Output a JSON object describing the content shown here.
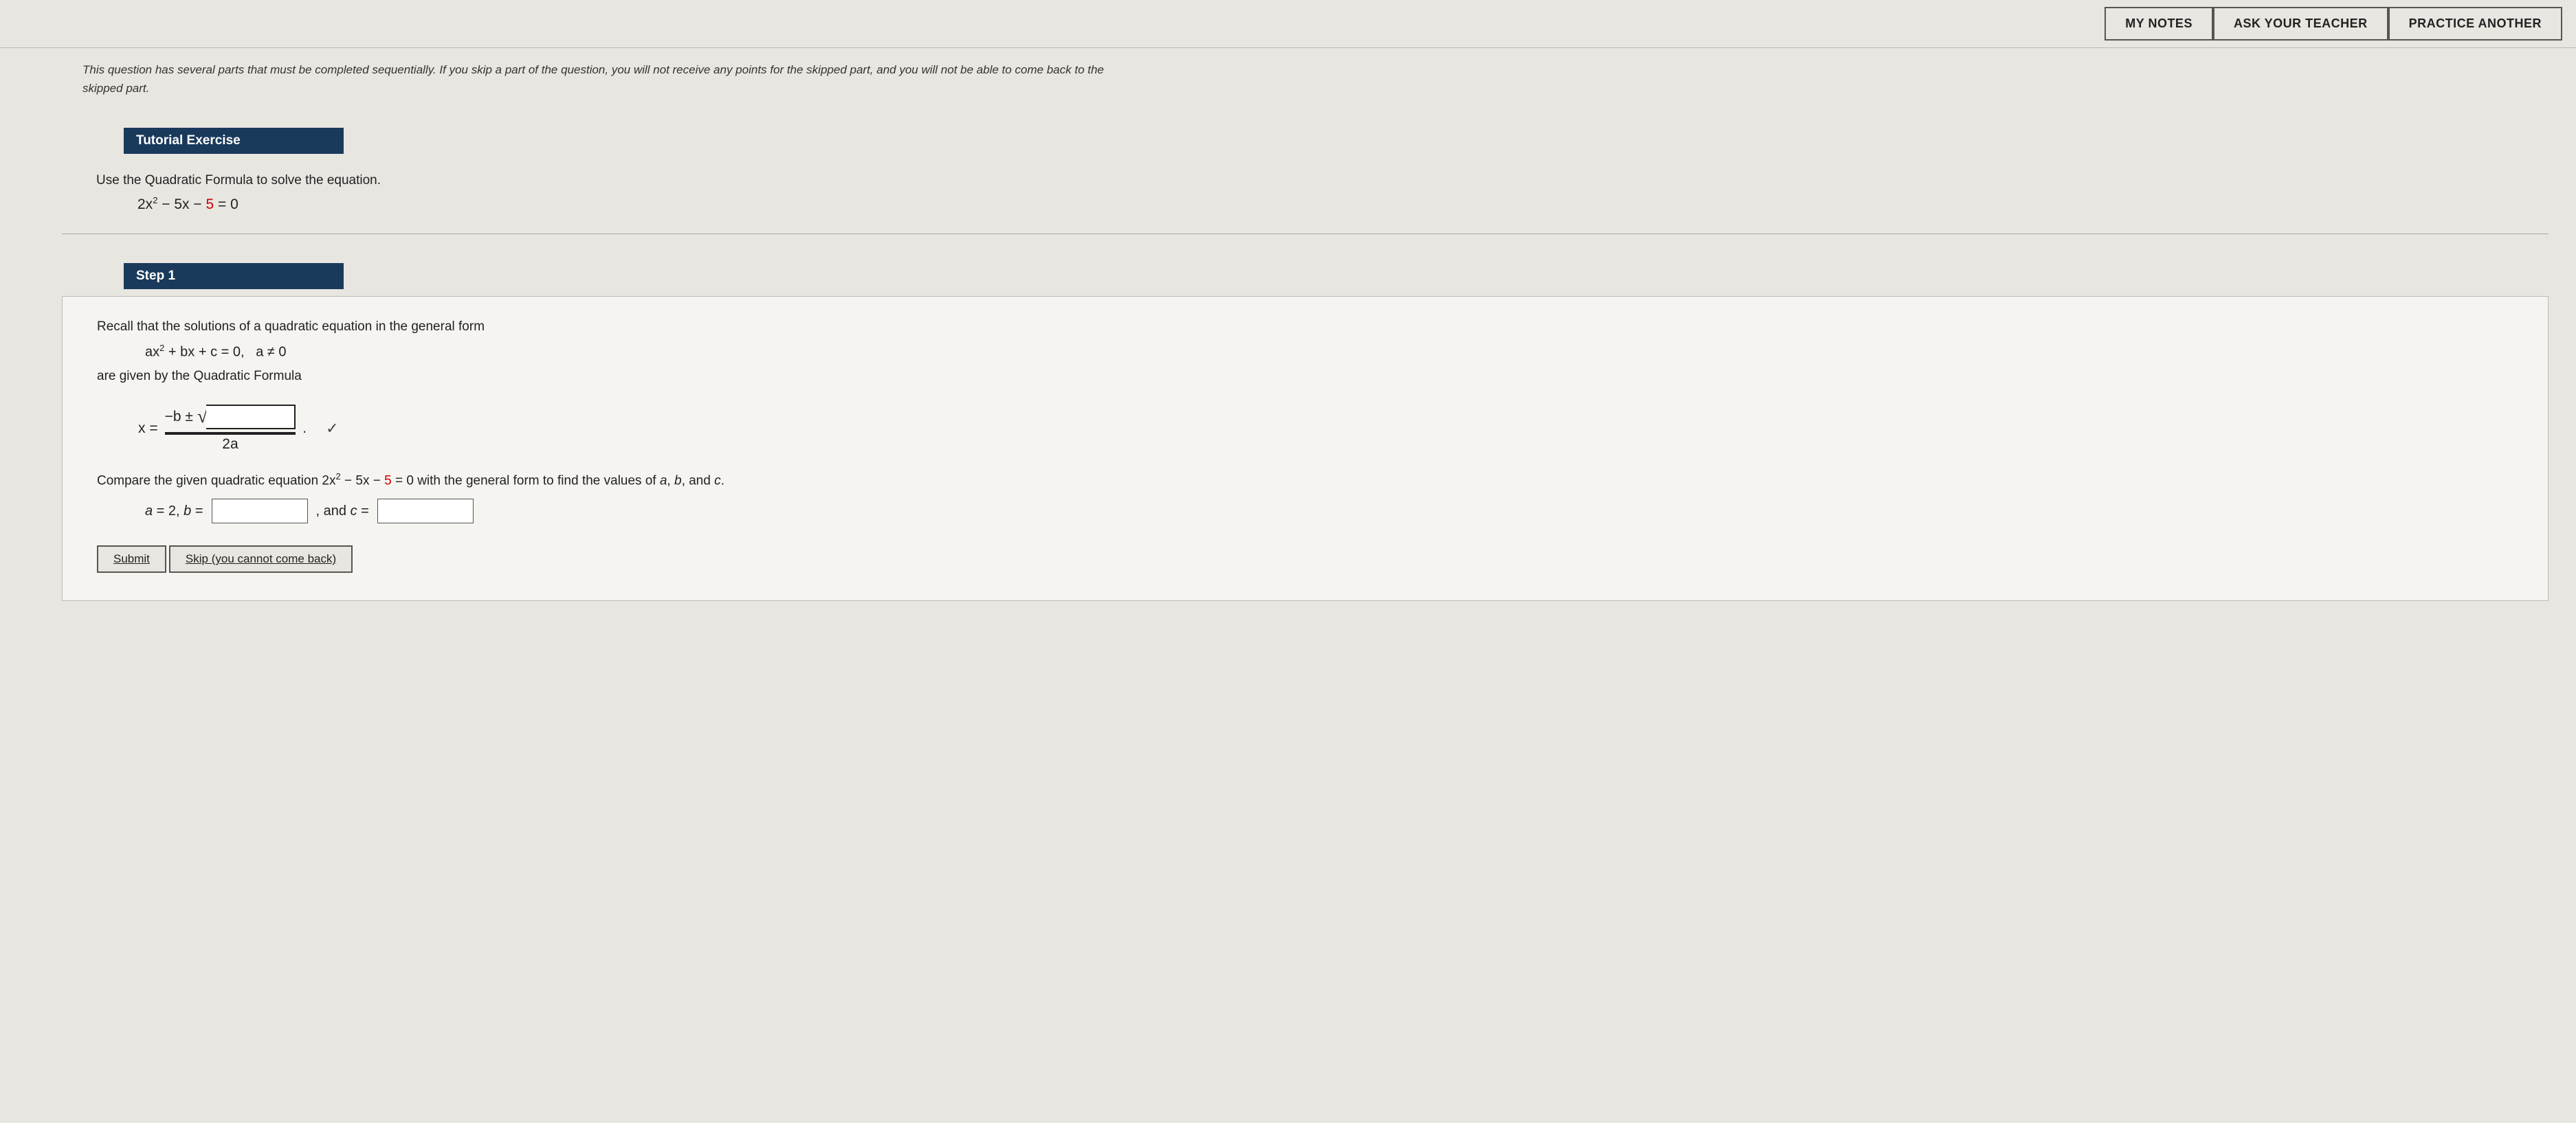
{
  "header": {
    "my_notes_label": "MY NOTES",
    "ask_teacher_label": "ASK YOUR TEACHER",
    "practice_another_label": "PRACTICE ANOTHER"
  },
  "intro": {
    "text": "This question has several parts that must be completed sequentially. If you skip a part of the question, you will not receive any points for the skipped part, and you will not be able to come back to the skipped part."
  },
  "tutorial": {
    "header": "Tutorial Exercise",
    "instruction": "Use the Quadratic Formula to solve the equation.",
    "equation": "2x² − 5x − 5 = 0"
  },
  "step1": {
    "header": "Step 1",
    "recall_text": "Recall that the solutions of a quadratic equation in the general form",
    "general_form": "ax² + bx + c = 0,  a ≠ 0",
    "given_by_text": "are given by the Quadratic Formula",
    "formula_x_equals": "x =",
    "formula_numerator_text": "−b ±",
    "formula_denominator": "2a",
    "compare_text": "Compare the given quadratic equation 2x² − 5x − 5 = 0 with the general form to find the values of a, b, and c.",
    "values_text": "a = 2, b =",
    "and_c_text": ", and c =",
    "submit_label": "Submit",
    "skip_label": "Skip (you cannot come back)"
  }
}
